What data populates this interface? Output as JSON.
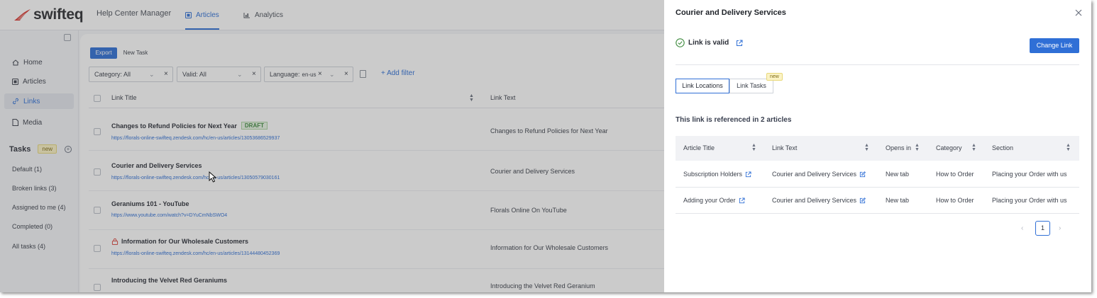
{
  "app": {
    "logo_text": "swifteq",
    "app_name": "Help Center Manager",
    "nav_tabs": [
      {
        "label": "Articles",
        "icon": "article-icon"
      },
      {
        "label": "Analytics",
        "icon": "chart-icon"
      }
    ]
  },
  "sidebar": {
    "items": [
      {
        "label": "Home",
        "icon": "home-icon"
      },
      {
        "label": "Articles",
        "icon": "article-icon"
      },
      {
        "label": "Links",
        "icon": "link-icon"
      },
      {
        "label": "Media",
        "icon": "media-icon"
      }
    ],
    "tasks_title": "Tasks",
    "tasks_badge": "new",
    "tasks": [
      "Default (1)",
      "Broken links (3)",
      "Assigned to me (4)",
      "Completed (0)",
      "All tasks (4)"
    ]
  },
  "toolbar": {
    "export_label": "Export",
    "new_task_label": "New Task",
    "filters": {
      "category": "Category: All",
      "valid": "Valid: All",
      "language": "Language:",
      "language_chip": "en-us"
    },
    "add_filter_label": "+ Add filter"
  },
  "grid": {
    "columns": [
      "Link Title",
      "Link Text"
    ],
    "rows": [
      {
        "title": "Changes to Refund Policies for Next Year",
        "badge": "DRAFT",
        "url": "https://florals-online-swifteq.zendesk.com/hc/en-us/articles/13053686529937",
        "text": "Changes to Refund Policies for Next Year"
      },
      {
        "title": "Courier and Delivery Services",
        "url": "https://florals-online-swifteq.zendesk.com/hc/en-us/articles/13050579030161",
        "text": "Courier and Delivery Services"
      },
      {
        "title": "Geraniums 101 - YouTube",
        "url": "https://www.youtube.com/watch?v=DYuCmNbSWO4",
        "text": "Florals Online On YouTube"
      },
      {
        "title": "Information for Our Wholesale Customers",
        "url": "https://florals-online-swifteq.zendesk.com/hc/en-us/articles/13144480452369",
        "text": "Information for Our Wholesale Customers"
      },
      {
        "title": "Introducing the Velvet Red Geraniums",
        "url": "",
        "text": "Introducing the Velvet Red Geranium"
      }
    ]
  },
  "panel": {
    "title": "Courier and Delivery Services",
    "status": "Link is valid",
    "change_link_label": "Change Link",
    "tabs": [
      "Link Locations",
      "Link Tasks"
    ],
    "tab_badge": "new",
    "ref_text": "This link is referenced in 2 articles",
    "columns": [
      "Article Title",
      "Link Text",
      "Opens in",
      "Category",
      "Section"
    ],
    "rows": [
      {
        "article": "Subscription Holders",
        "link_text": "Courier and Delivery Services",
        "opens_in": "New tab",
        "category": "How to Order",
        "section": "Placing your Order with us"
      },
      {
        "article": "Adding your Order",
        "link_text": "Courier and Delivery Services",
        "opens_in": "New tab",
        "category": "How to Order",
        "section": "Placing your Order with us"
      }
    ],
    "page": "1"
  },
  "colors": {
    "accent": "#2f6fd6",
    "valid_green": "#3f8c3f",
    "draft_green": "#3f8c3f",
    "badge_yellow": "#fbf3c5"
  }
}
